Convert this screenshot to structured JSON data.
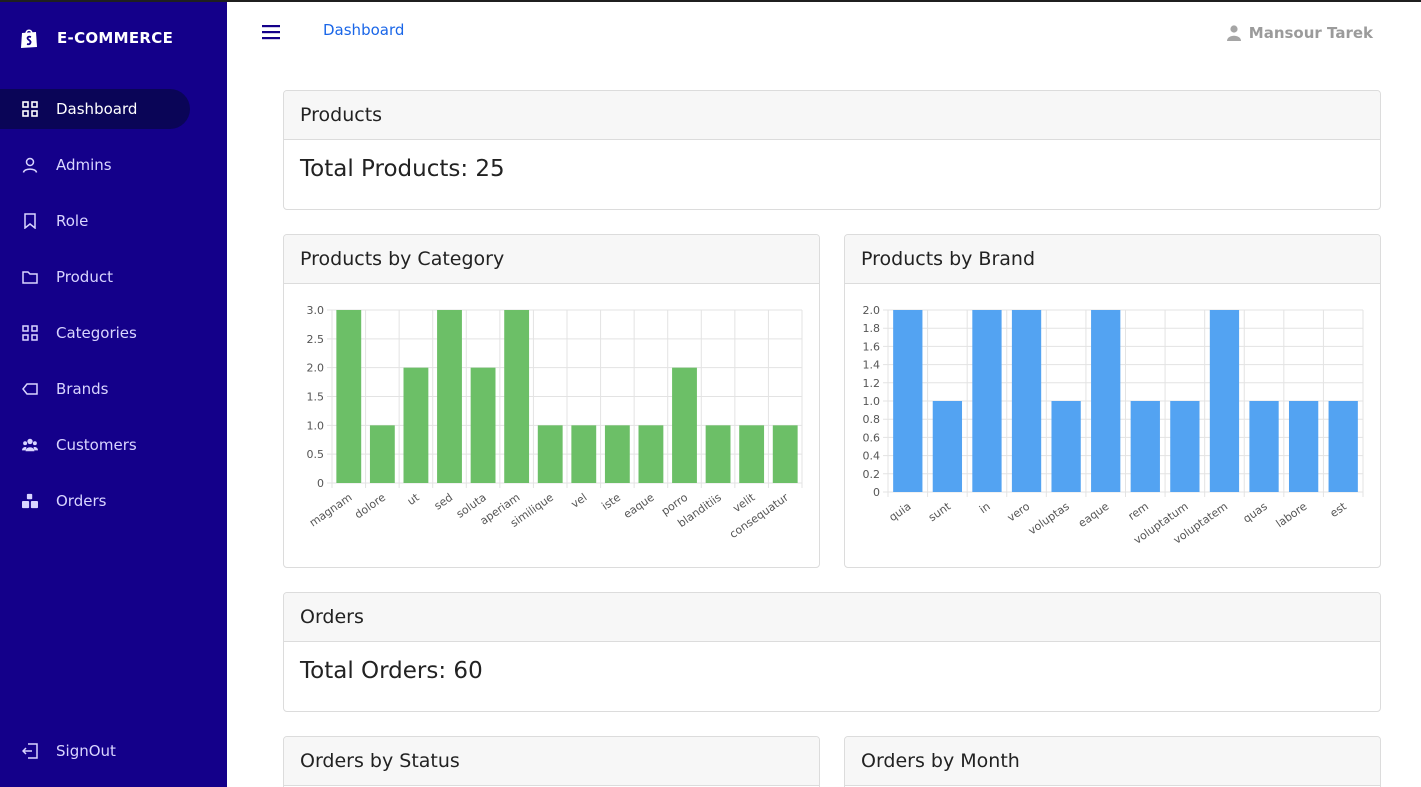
{
  "app": {
    "brand": "E-COMMERCE"
  },
  "sidebar": {
    "items": [
      {
        "label": "Dashboard",
        "icon": "grid-icon",
        "active": true
      },
      {
        "label": "Admins",
        "icon": "user-icon"
      },
      {
        "label": "Role",
        "icon": "bookmark-icon"
      },
      {
        "label": "Product",
        "icon": "folder-icon"
      },
      {
        "label": "Categories",
        "icon": "grid-icon"
      },
      {
        "label": "Brands",
        "icon": "tag-icon"
      },
      {
        "label": "Customers",
        "icon": "users-icon"
      },
      {
        "label": "Orders",
        "icon": "boxes-icon"
      }
    ],
    "signout": "SignOut"
  },
  "header": {
    "breadcrumb": "Dashboard",
    "user_name": "Mansour Tarek"
  },
  "cards": {
    "products_title": "Products",
    "products_total": "Total Products: 25",
    "category_title": "Products by Category",
    "brand_title": "Products by Brand",
    "orders_title": "Orders",
    "orders_total": "Total Orders: 60",
    "status_title": "Orders by Status",
    "month_title": "Orders by Month"
  },
  "colors": {
    "sidebar": "#14008a",
    "active": "#0a0557",
    "category_bar": "#6cbf67",
    "brand_bar": "#53a3f2",
    "link": "#1a66e8"
  },
  "chart_data": [
    {
      "id": "category",
      "type": "bar",
      "categories": [
        "magnam",
        "dolore",
        "ut",
        "sed",
        "soluta",
        "aperiam",
        "similique",
        "vel",
        "iste",
        "eaque",
        "porro",
        "blanditiis",
        "velit",
        "consequatur"
      ],
      "values": [
        3,
        1,
        2,
        3,
        2,
        3,
        1,
        1,
        1,
        1,
        2,
        1,
        1,
        1
      ],
      "ylim": [
        0,
        3
      ],
      "yticks": [
        "0",
        "0.5",
        "1.0",
        "1.5",
        "2.0",
        "2.5",
        "3.0"
      ],
      "grid": true
    },
    {
      "id": "brand",
      "type": "bar",
      "categories": [
        "quia",
        "sunt",
        "in",
        "vero",
        "voluptas",
        "eaque",
        "rem",
        "voluptatum",
        "voluptatem",
        "quas",
        "labore",
        "est"
      ],
      "values": [
        2,
        1,
        2,
        2,
        1,
        2,
        1,
        1,
        2,
        1,
        1,
        1
      ],
      "ylim": [
        0,
        2
      ],
      "yticks": [
        "0",
        "0.2",
        "0.4",
        "0.6",
        "0.8",
        "1.0",
        "1.2",
        "1.4",
        "1.6",
        "1.8",
        "2.0"
      ],
      "grid": true
    }
  ]
}
